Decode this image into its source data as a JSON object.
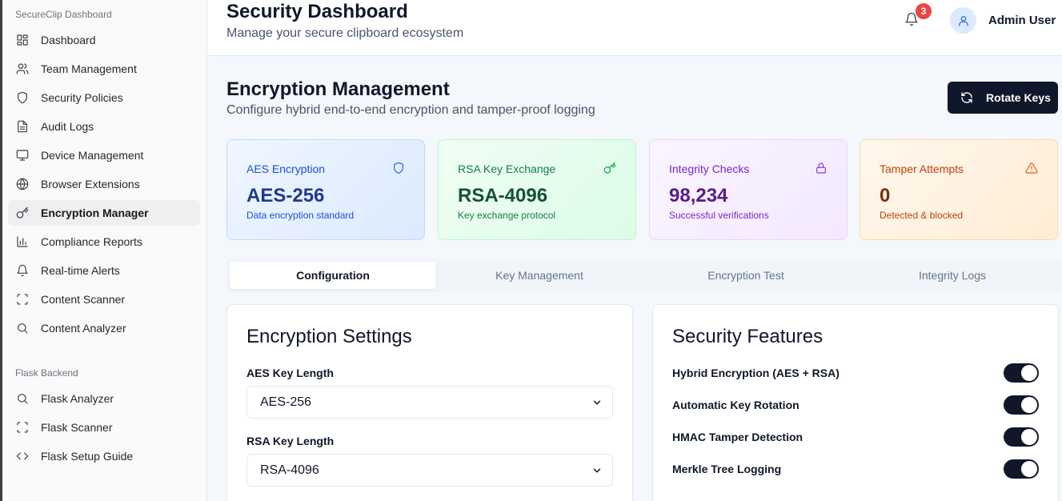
{
  "sidebar": {
    "section1": "SecureClip Dashboard",
    "items": [
      {
        "label": "Dashboard",
        "icon": "dashboard-icon"
      },
      {
        "label": "Team Management",
        "icon": "users-icon"
      },
      {
        "label": "Security Policies",
        "icon": "shield-icon"
      },
      {
        "label": "Audit Logs",
        "icon": "file-text-icon"
      },
      {
        "label": "Device Management",
        "icon": "monitor-icon"
      },
      {
        "label": "Browser Extensions",
        "icon": "globe-icon"
      },
      {
        "label": "Encryption Manager",
        "icon": "key-icon",
        "active": true
      },
      {
        "label": "Compliance Reports",
        "icon": "bar-chart-icon"
      },
      {
        "label": "Real-time Alerts",
        "icon": "bell-icon"
      },
      {
        "label": "Content Scanner",
        "icon": "scan-icon"
      },
      {
        "label": "Content Analyzer",
        "icon": "search-icon"
      }
    ],
    "section2": "Flask Backend",
    "items2": [
      {
        "label": "Flask Analyzer",
        "icon": "search-icon"
      },
      {
        "label": "Flask Scanner",
        "icon": "scan-icon"
      },
      {
        "label": "Flask Setup Guide",
        "icon": "code-icon"
      }
    ]
  },
  "header": {
    "title": "Security Dashboard",
    "subtitle": "Manage your secure clipboard ecosystem",
    "notification_count": "3",
    "user_name": "Admin User"
  },
  "main": {
    "title": "Encryption Management",
    "subtitle": "Configure hybrid end-to-end encryption and tamper-proof logging",
    "rotate_label": "Rotate Keys",
    "stats": [
      {
        "label": "AES Encryption",
        "value": "AES-256",
        "desc": "Data encryption standard",
        "icon": "shield-icon",
        "color": "#2563eb"
      },
      {
        "label": "RSA Key Exchange",
        "value": "RSA-4096",
        "desc": "Key exchange protocol",
        "icon": "key-icon",
        "color": "#16a34a"
      },
      {
        "label": "Integrity Checks",
        "value": "98,234",
        "desc": "Successful verifications",
        "icon": "lock-icon",
        "color": "#9333ea"
      },
      {
        "label": "Tamper Attempts",
        "value": "0",
        "desc": "Detected & blocked",
        "icon": "alert-triangle-icon",
        "color": "#ea580c"
      }
    ],
    "tabs": [
      "Configuration",
      "Key Management",
      "Encryption Test",
      "Integrity Logs"
    ],
    "settings": {
      "title": "Encryption Settings",
      "aes_label": "AES Key Length",
      "aes_value": "AES-256",
      "rsa_label": "RSA Key Length",
      "rsa_value": "RSA-4096"
    },
    "features": {
      "title": "Security Features",
      "items": [
        {
          "label": "Hybrid Encryption (AES + RSA)",
          "enabled": true
        },
        {
          "label": "Automatic Key Rotation",
          "enabled": true
        },
        {
          "label": "HMAC Tamper Detection",
          "enabled": true
        },
        {
          "label": "Merkle Tree Logging",
          "enabled": true
        }
      ]
    }
  }
}
